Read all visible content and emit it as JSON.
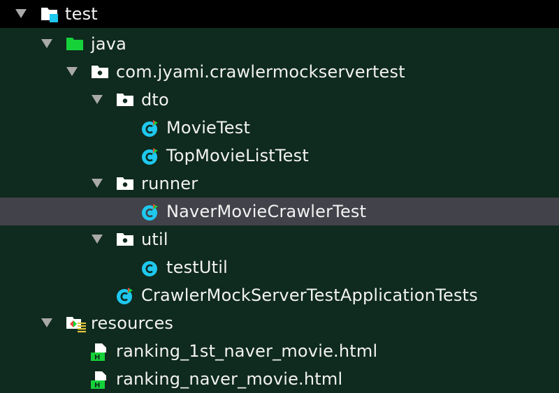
{
  "tree": {
    "root": {
      "label": "test",
      "icon": "test-folder-icon"
    },
    "java": {
      "label": "java",
      "icon": "source-root-folder-icon"
    },
    "package": {
      "label": "com.jyami.crawlermockservertest",
      "icon": "package-icon"
    },
    "dto": {
      "label": "dto",
      "icon": "package-icon"
    },
    "movie_test": {
      "label": "MovieTest",
      "icon": "test-class-icon"
    },
    "top_movie_list_test": {
      "label": "TopMovieListTest",
      "icon": "test-class-icon"
    },
    "runner": {
      "label": "runner",
      "icon": "package-icon"
    },
    "naver_crawler_test": {
      "label": "NaverMovieCrawlerTest",
      "icon": "test-class-icon",
      "selected": true
    },
    "util": {
      "label": "util",
      "icon": "package-icon"
    },
    "test_util": {
      "label": "testUtil",
      "icon": "class-icon"
    },
    "app_tests": {
      "label": "CrawlerMockServerTestApplicationTests",
      "icon": "test-class-icon"
    },
    "resources": {
      "label": "resources",
      "icon": "test-resources-folder-icon"
    },
    "file1": {
      "label": "ranking_1st_naver_movie.html",
      "icon": "html-file-icon"
    },
    "file2": {
      "label": "ranking_naver_movie.html",
      "icon": "html-file-icon"
    }
  },
  "colors": {
    "background": "#0f2a1e",
    "top_row": "#000000",
    "selection": "#42424a",
    "text": "#f2f2f2",
    "arrow": "#a9a9a9",
    "class_icon": "#1ec8ef",
    "green": "#16d23a"
  }
}
